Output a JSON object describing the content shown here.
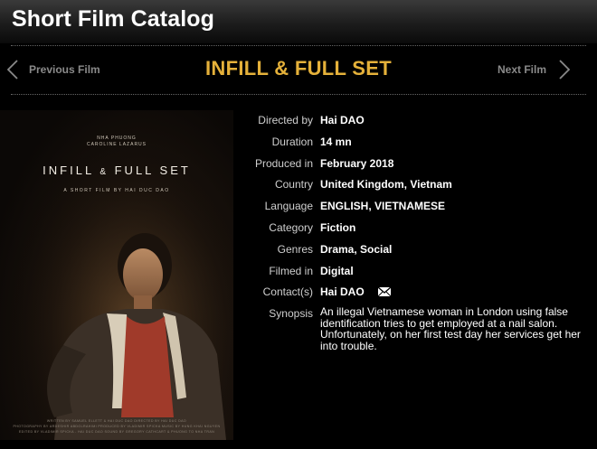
{
  "app": {
    "title": "Short Film Catalog"
  },
  "nav": {
    "previous_label": "Previous Film",
    "next_label": "Next Film",
    "film_title": "INFILL & FULL SET"
  },
  "poster": {
    "cast": "NHA PHUONG\nCAROLINE LAZARUS",
    "title_part1": "INFILL ",
    "title_amp": "&",
    "title_part2": " FULL SET",
    "byline": "A SHORT FILM BY HAI DUC DAO",
    "credits": "WRITTEN BY SAMUEL ELLETT & HAI DUC DAO   DIRECTED BY HAI DUC DAO\nPHOTOGRAPHY BY ARDESHIR ABDOLRAHIMI   PRODUCED BY VLADIMIR SPICKA   MUSIC BY HUNG KHAI NGUYEN\nEDITED BY VLADIMIR SPICKA - HAI DUC DAO   SOUND BY GREGORY CATHCART & PHUONG TO NHA TRAN"
  },
  "details": {
    "directed_by": {
      "label": "Directed by",
      "value": "Hai DAO"
    },
    "duration": {
      "label": "Duration",
      "value": "14 mn"
    },
    "produced_in": {
      "label": "Produced in",
      "value": "February 2018"
    },
    "country": {
      "label": "Country",
      "value": "United Kingdom, Vietnam"
    },
    "language": {
      "label": "Language",
      "value": "ENGLISH, VIETNAMESE"
    },
    "category": {
      "label": "Category",
      "value": "Fiction"
    },
    "genres": {
      "label": "Genres",
      "value": "Drama, Social"
    },
    "filmed_in": {
      "label": "Filmed in",
      "value": "Digital"
    },
    "contacts": {
      "label": "Contact(s)",
      "value": "Hai DAO",
      "icon": "envelope-icon"
    },
    "synopsis": {
      "label": "Synopsis",
      "value": "An illegal Vietnamese woman in London using false identification tries to get employed at a nail salon. Unfortunately, on her first test day her services get her into trouble."
    }
  },
  "colors": {
    "title_accent": "#e5b13a",
    "nav_text": "#8a8a8a",
    "background": "#000000"
  }
}
